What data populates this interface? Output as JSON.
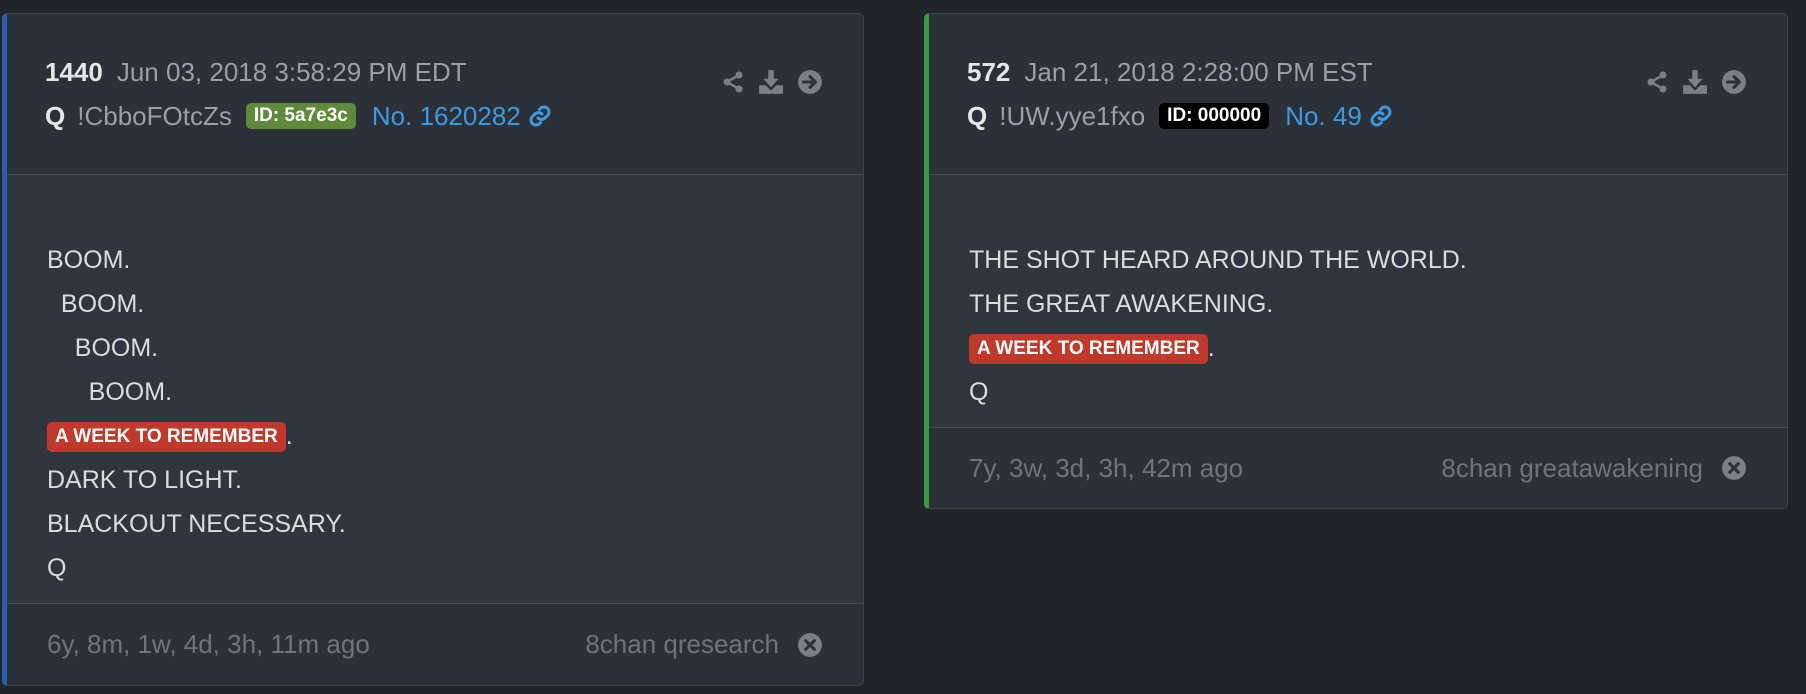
{
  "colors": {
    "background": "#21252b",
    "card": "#2c3038",
    "accent_blue": "#2a5db0",
    "accent_green": "#3c9a3c",
    "link": "#3e9ae0",
    "tag_red": "#c0392b"
  },
  "posts": [
    {
      "number": "1440",
      "date": "Jun 03, 2018 3:58:29 PM EDT",
      "author": "Q",
      "tripcode": "!CbboFOtcZs",
      "id_badge": "ID: 5a7e3c",
      "post_link": "No. 1620282",
      "lines": [
        "BOOM.",
        "  BOOM.",
        "    BOOM.",
        "      BOOM."
      ],
      "tag": "A WEEK TO REMEMBER",
      "tag_suffix": ".",
      "lines_after": [
        "DARK TO LIGHT.",
        "BLACKOUT NECESSARY.",
        "Q"
      ],
      "ago": "6y, 8m, 1w, 4d, 3h, 11m ago",
      "source": "8chan qresearch",
      "icons": [
        "share-icon",
        "download-icon",
        "arrow-right-circle-icon",
        "link-icon",
        "close-circle-icon"
      ]
    },
    {
      "number": "572",
      "date": "Jan 21, 2018 2:28:00 PM EST",
      "author": "Q",
      "tripcode": "!UW.yye1fxo",
      "id_badge": "ID: 000000",
      "post_link": "No. 49",
      "lines": [
        "THE SHOT HEARD AROUND THE WORLD.",
        "THE GREAT AWAKENING."
      ],
      "tag": "A WEEK TO REMEMBER",
      "tag_suffix": ".",
      "lines_after": [
        "Q"
      ],
      "ago": "7y, 3w, 3d, 3h, 42m ago",
      "source": "8chan greatawakening",
      "icons": [
        "share-icon",
        "download-icon",
        "arrow-right-circle-icon",
        "link-icon",
        "close-circle-icon"
      ]
    }
  ]
}
